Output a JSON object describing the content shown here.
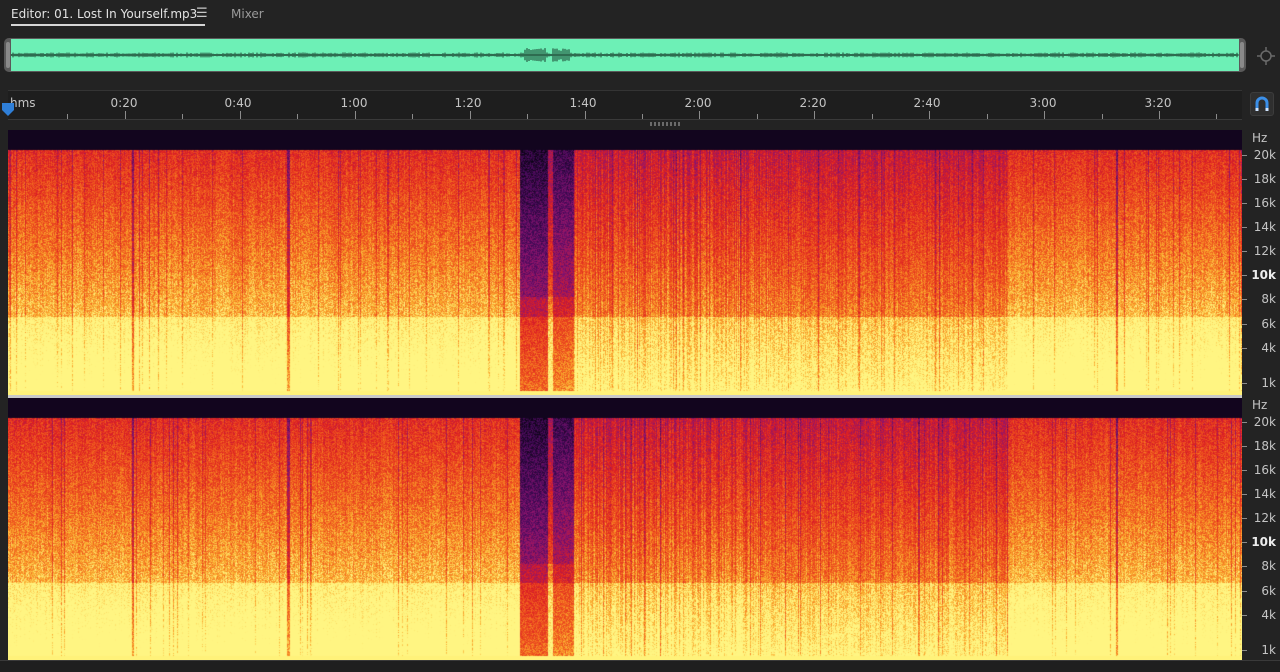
{
  "tabs": {
    "editor_label": "Editor: 01. Lost In Yourself.mp3",
    "mixer_label": "Mixer"
  },
  "ruler": {
    "labels": [
      "hms",
      "0:20",
      "0:40",
      "1:00",
      "1:20",
      "1:40",
      "2:00",
      "2:20",
      "2:40",
      "3:00",
      "3:20"
    ]
  },
  "freq_axis": {
    "unit": "Hz",
    "labels": [
      "20k",
      "18k",
      "16k",
      "14k",
      "12k",
      "10k",
      "8k",
      "6k",
      "4k",
      "1k"
    ],
    "bold_label": "10k"
  },
  "colors": {
    "overview_waveform_bg": "#6df0b6",
    "playhead": "#2f7fd8",
    "spectrogram_low": "#fff07a",
    "spectrogram_mid": "#e8231c",
    "spectrogram_high": "#6a1670"
  },
  "icons": {
    "tab_menu": "hamburger-icon",
    "zoom": "zoom-target-icon",
    "snap": "magnet-icon",
    "playhead": "playhead-marker-icon"
  }
}
